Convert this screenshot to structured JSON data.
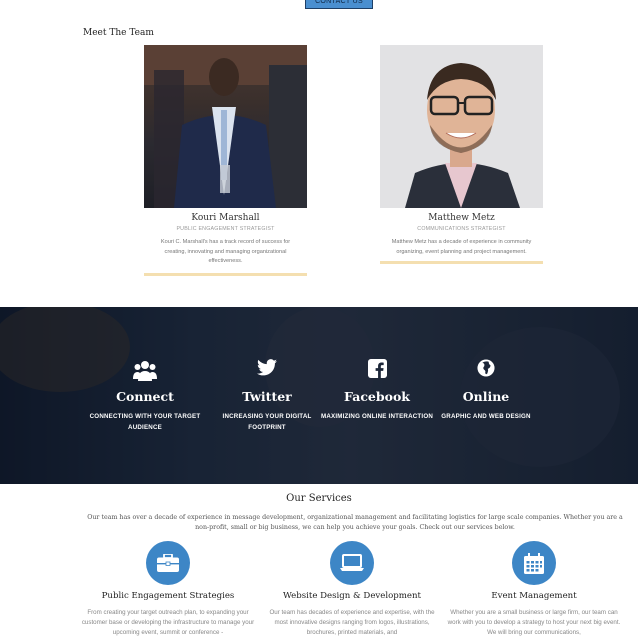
{
  "header": {
    "contact_label": "CONTACT US"
  },
  "team": {
    "heading": "Meet The Team",
    "members": [
      {
        "name": "Kouri Marshall",
        "role": "PUBLIC ENGAGEMENT STRATEGIST",
        "bio": "Kouri C. Marshall's has a track record of success for creating, innovating and managing organizational effectiveness."
      },
      {
        "name": "Matthew Metz",
        "role": "COMMUNICATIONS STRATEGIST",
        "bio": "Matthew Metz has a decade of experience in community organizing, event planning and project management."
      }
    ]
  },
  "features": [
    {
      "icon": "people-icon",
      "title": "Connect",
      "subtitle": "CONNECTING WITH YOUR TARGET AUDIENCE"
    },
    {
      "icon": "twitter-icon",
      "title": "Twitter",
      "subtitle": "INCREASING YOUR DIGITAL FOOTPRINT"
    },
    {
      "icon": "facebook-icon",
      "title": "Facebook",
      "subtitle": "MAXIMIZING ONLINE INTERACTION"
    },
    {
      "icon": "globe-icon",
      "title": "Online",
      "subtitle": "GRAPHIC AND WEB DESIGN"
    }
  ],
  "services": {
    "title": "Our Services",
    "intro": "Our team has over a decade of experience in message development, organizational management and facilitating logistics for large scale companies. Whether you are a non-profit, small or big business, we can help you achieve your goals. Check out our services below.",
    "items": [
      {
        "icon": "briefcase-icon",
        "title": "Public Engagement Strategies",
        "desc": "From creating your target outreach plan, to expanding your customer base or developing the infrastructure to manage your upcoming event, summit or conference -"
      },
      {
        "icon": "laptop-icon",
        "title": "Website Design & Development",
        "desc": "Our team has decades of experience and expertise, with the most innovative designs ranging from logos, illustrations, brochures, printed materials, and"
      },
      {
        "icon": "calendar-icon",
        "title": "Event Management",
        "desc": "Whether you are a small business or large firm, our team can work with you to develop a strategy to host your next big event. We will bring our communications,"
      }
    ]
  },
  "colors": {
    "accent_blue": "#3d86c6",
    "bio_bar": "#f4dfb0",
    "band_dark": "#1c2638"
  }
}
